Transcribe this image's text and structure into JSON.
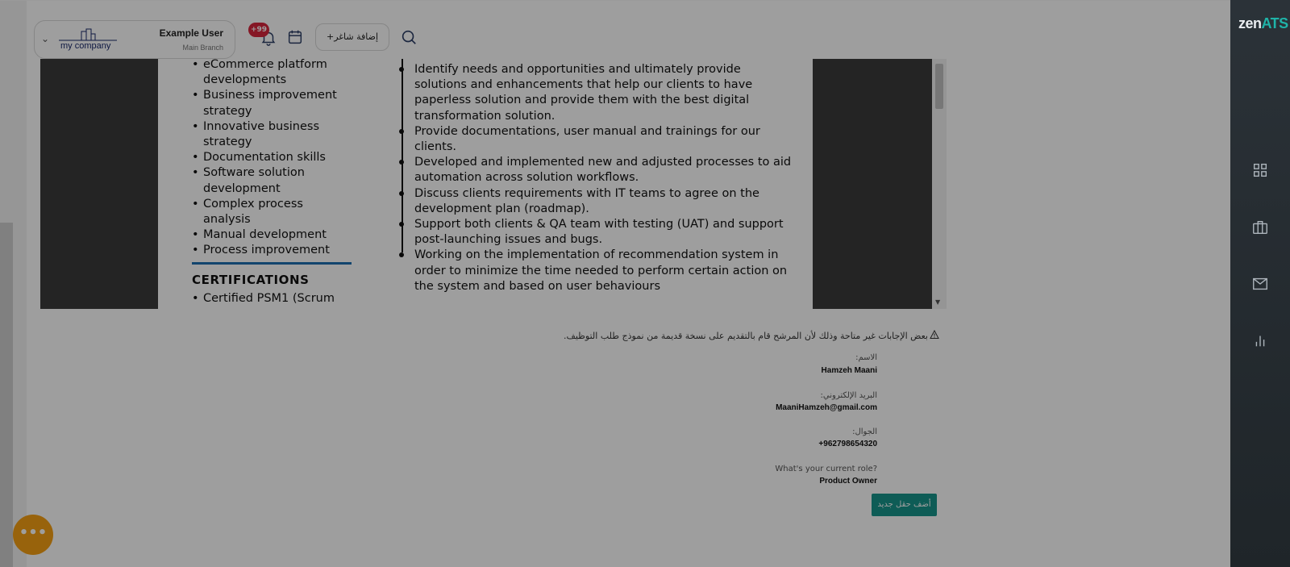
{
  "brand": {
    "logo_main": "zen",
    "logo_accent": "ATS",
    "accent_color": "#1fb3a8",
    "primary_color": "#17958c"
  },
  "header": {
    "user_name": "Example User",
    "branch": "Main Branch",
    "company_name": "my company",
    "notification_badge": "+99",
    "add_candidate_label": "+إضافة شاغر"
  },
  "resume": {
    "skills": [
      "eCommerce platform developments",
      "Business improvement strategy",
      "Innovative business strategy",
      "Documentation skills",
      "Software solution development",
      "Complex process analysis",
      "Manual development",
      "Process improvement"
    ],
    "certifications_title": "CERTIFICATIONS",
    "certification_first": "Certified PSM1 (Scrum",
    "responsibilities": [
      "Identify needs and opportunities and ultimately provide solutions and enhancements that help our clients to have paperless solution and provide them with the best digital transformation solution.",
      "Provide documentations, user manual and trainings for our clients.",
      "Developed and implemented new and adjusted processes to aid automation across solution workflows.",
      "Discuss clients requirements with IT teams to agree on the development plan (roadmap).",
      "Support both clients & QA team with testing (UAT) and support post-launching issues and bugs.",
      "Working on the implementation of recommendation system in order to minimize the time needed to perform certain action on the system and based on user behaviours"
    ]
  },
  "notice": {
    "text": "بعض الإجابات غير متاحة وذلك لأن المرشح قام بالتقديم على نسخة قديمة من نموذج طلب التوظيف."
  },
  "fields": [
    {
      "label": "الاسم:",
      "value": "Hamzeh Maani"
    },
    {
      "label": "البريد الإلكتروني:",
      "value": "MaaniHamzeh@gmail.com"
    },
    {
      "label": "الجوال:",
      "value": "+962798654320"
    },
    {
      "label": "?What's your current role",
      "value": "Product Owner"
    }
  ],
  "add_field_label": "أضف حقل جديد",
  "fab_label": "•••"
}
